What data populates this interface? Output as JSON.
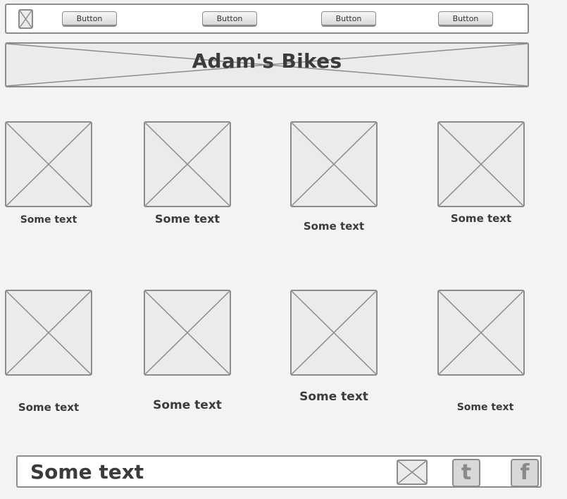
{
  "nav": {
    "logo": {
      "icon": "image-placeholder-icon"
    },
    "buttons": [
      {
        "label": "Button"
      },
      {
        "label": "Button"
      },
      {
        "label": "Button"
      },
      {
        "label": "Button"
      }
    ]
  },
  "header": {
    "title": "Adam's Bikes",
    "background_icon": "image-placeholder-icon"
  },
  "grid": {
    "items": [
      {
        "caption": "Some text",
        "icon": "image-placeholder-icon"
      },
      {
        "caption": "Some text",
        "icon": "image-placeholder-icon"
      },
      {
        "caption": "Some text",
        "icon": "image-placeholder-icon"
      },
      {
        "caption": "Some text",
        "icon": "image-placeholder-icon"
      },
      {
        "caption": "Some text",
        "icon": "image-placeholder-icon"
      },
      {
        "caption": "Some text",
        "icon": "image-placeholder-icon"
      },
      {
        "caption": "Some text",
        "icon": "image-placeholder-icon"
      },
      {
        "caption": "Some text",
        "icon": "image-placeholder-icon"
      }
    ]
  },
  "footer": {
    "text": "Some text",
    "mail_icon": "image-placeholder-icon",
    "social": [
      {
        "name": "twitter",
        "icon": "twitter-icon",
        "glyph": "t"
      },
      {
        "name": "facebook",
        "icon": "facebook-icon",
        "glyph": "f"
      }
    ]
  },
  "colors": {
    "background": "#f3f3f3",
    "border": "#8c8c8c",
    "placeholder_fill": "#ebebeb",
    "text": "#3b3b3b"
  }
}
